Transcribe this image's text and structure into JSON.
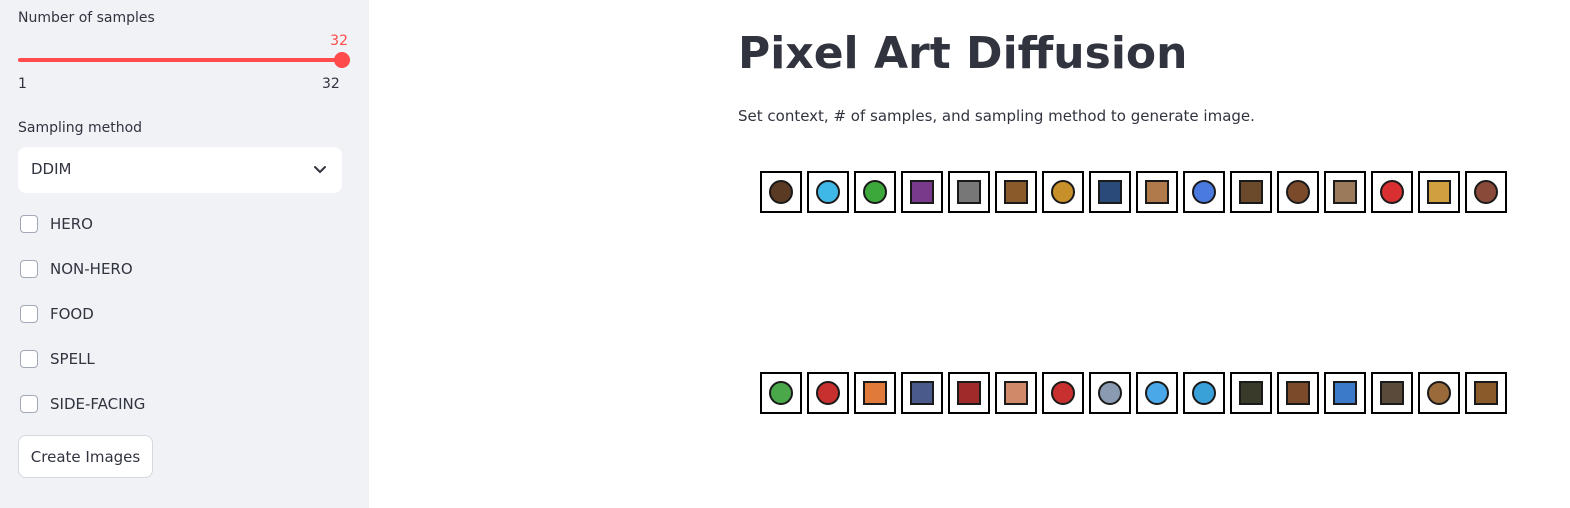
{
  "sidebar": {
    "slider": {
      "label": "Number of samples",
      "value": "32",
      "min": "1",
      "max": "32"
    },
    "select": {
      "label": "Sampling method",
      "value": "DDIM"
    },
    "checkboxes": [
      {
        "label": "HERO"
      },
      {
        "label": "NON-HERO"
      },
      {
        "label": "FOOD"
      },
      {
        "label": "SPELL"
      },
      {
        "label": "SIDE-FACING"
      }
    ],
    "button": "Create Images"
  },
  "main": {
    "title": "Pixel Art Diffusion",
    "description": "Set context, # of samples, and sampling method to generate image."
  },
  "sprites": {
    "row1": [
      {
        "icon": "face-sprite-icon",
        "color": "#5a3a22"
      },
      {
        "icon": "creature-sprite-icon",
        "color": "#3fb8e8"
      },
      {
        "icon": "creature-sprite-icon",
        "color": "#3ca83c"
      },
      {
        "icon": "character-sprite-icon",
        "color": "#7a3a8c"
      },
      {
        "icon": "bow-sprite-icon",
        "color": "#777777"
      },
      {
        "icon": "shield-sprite-icon",
        "color": "#8a5a2a"
      },
      {
        "icon": "coin-sprite-icon",
        "color": "#c8902a"
      },
      {
        "icon": "box-sprite-icon",
        "color": "#2a4a7a"
      },
      {
        "icon": "scroll-sprite-icon",
        "color": "#b07a4a"
      },
      {
        "icon": "creature-sprite-icon",
        "color": "#4a7ae0"
      },
      {
        "icon": "book-sprite-icon",
        "color": "#6a4a2a"
      },
      {
        "icon": "food-sprite-icon",
        "color": "#7a4a2a"
      },
      {
        "icon": "chest-sprite-icon",
        "color": "#9a7a5a"
      },
      {
        "icon": "creature-sprite-icon",
        "color": "#d83030"
      },
      {
        "icon": "potion-sprite-icon",
        "color": "#d0a040"
      },
      {
        "icon": "orb-sprite-icon",
        "color": "#8a4a3a"
      }
    ],
    "row2": [
      {
        "icon": "food-sprite-icon",
        "color": "#4aa84a"
      },
      {
        "icon": "creature-sprite-icon",
        "color": "#c83030"
      },
      {
        "icon": "potion-sprite-icon",
        "color": "#e07a3a"
      },
      {
        "icon": "chest-sprite-icon",
        "color": "#4a5a8a"
      },
      {
        "icon": "weapon-sprite-icon",
        "color": "#a02a2a"
      },
      {
        "icon": "scroll-sprite-icon",
        "color": "#d08a6a"
      },
      {
        "icon": "pouch-sprite-icon",
        "color": "#c83030"
      },
      {
        "icon": "orb-sprite-icon",
        "color": "#8a9ab0"
      },
      {
        "icon": "creature-sprite-icon",
        "color": "#4aa8e8"
      },
      {
        "icon": "creature-sprite-icon",
        "color": "#3aa0d8"
      },
      {
        "icon": "book-sprite-icon",
        "color": "#3a3a2a"
      },
      {
        "icon": "bow-sprite-icon",
        "color": "#7a4a2a"
      },
      {
        "icon": "weapon-sprite-icon",
        "color": "#3a7ac8"
      },
      {
        "icon": "character-sprite-icon",
        "color": "#5a4a3a"
      },
      {
        "icon": "food-sprite-icon",
        "color": "#9a6a3a"
      },
      {
        "icon": "weapon-sprite-icon",
        "color": "#8a5a2a"
      }
    ]
  }
}
